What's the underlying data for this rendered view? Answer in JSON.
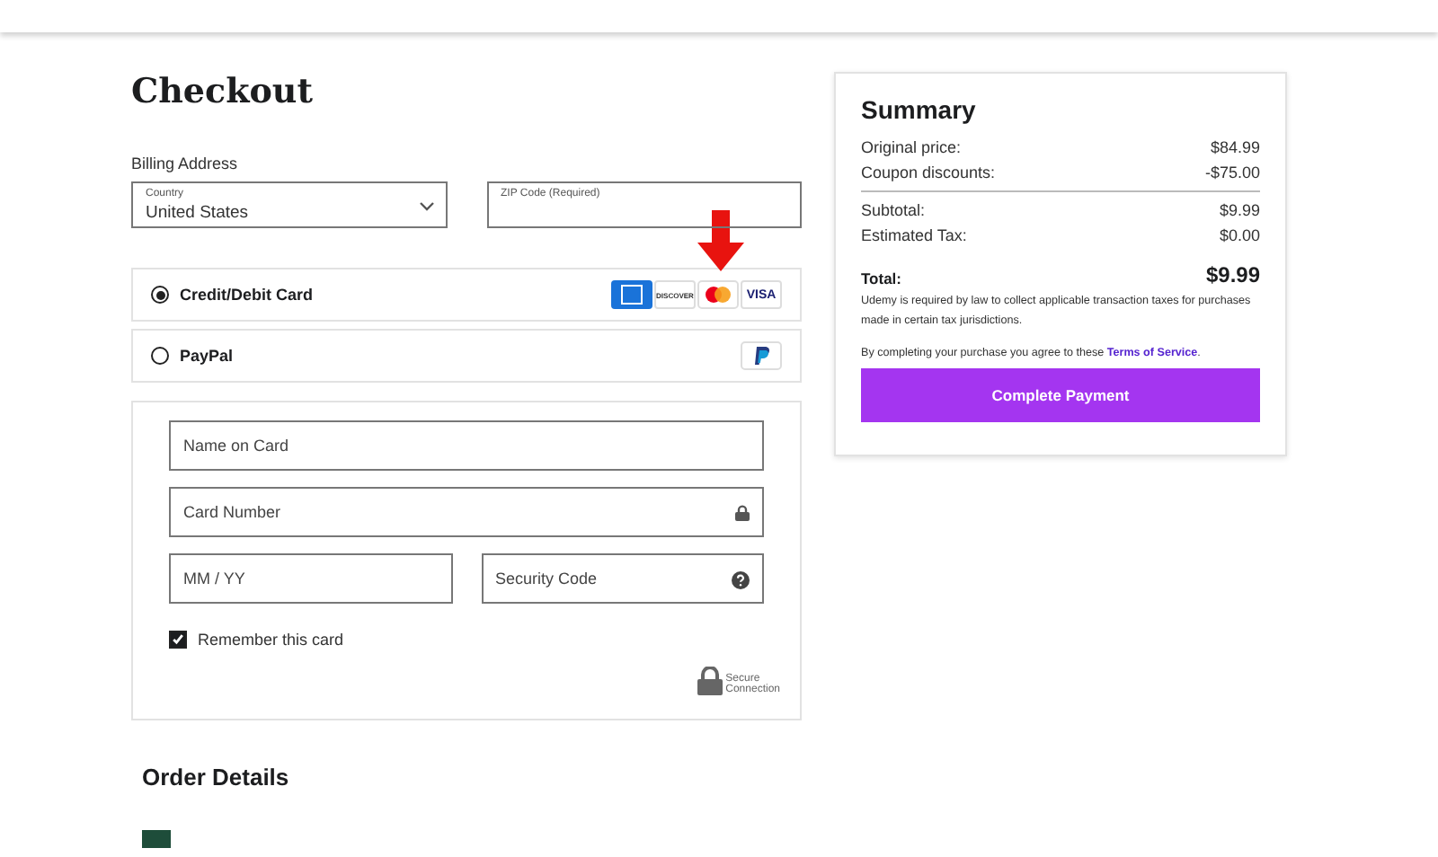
{
  "title": "Checkout",
  "billing": {
    "heading": "Billing Address",
    "country": {
      "label": "Country",
      "value": "United States"
    },
    "zip": {
      "label": "ZIP Code (Required)"
    }
  },
  "payment_methods": [
    {
      "kind": "card",
      "label": "Credit/Debit Card",
      "selected": true,
      "brands": [
        "DISCOVER",
        "VISA"
      ]
    },
    {
      "kind": "paypal",
      "label": "PayPal",
      "selected": false
    }
  ],
  "card_form": {
    "rows": [
      [
        {
          "kind": "plain",
          "placeholder": "Name on Card"
        }
      ],
      [
        {
          "kind": "lock",
          "placeholder": "Card Number"
        }
      ],
      [
        {
          "kind": "plain",
          "placeholder": "MM / YY"
        },
        {
          "kind": "help",
          "placeholder": "Security Code"
        }
      ]
    ],
    "remember": {
      "label": "Remember this card",
      "checked": true
    },
    "secure": [
      "Secure",
      "Connection"
    ]
  },
  "order_details": {
    "heading": "Order Details"
  },
  "summary": {
    "heading": "Summary",
    "rows": [
      {
        "label": "Original price:",
        "value": "$84.99"
      },
      {
        "label": "Coupon discounts:",
        "value": "-$75.00"
      }
    ],
    "subrows": [
      {
        "label": "Subtotal:",
        "value": "$9.99"
      },
      {
        "label": "Estimated Tax:",
        "value": "$0.00"
      }
    ],
    "total": {
      "label": "Total:",
      "value": "$9.99"
    },
    "tax_note": "Udemy is required by law to collect applicable transaction taxes for purchases made in certain tax jurisdictions.",
    "terms_prefix": "By completing your purchase you agree to these",
    "terms_link": "Terms of Service",
    "terms_suffix": ".",
    "button": "Complete Payment"
  }
}
